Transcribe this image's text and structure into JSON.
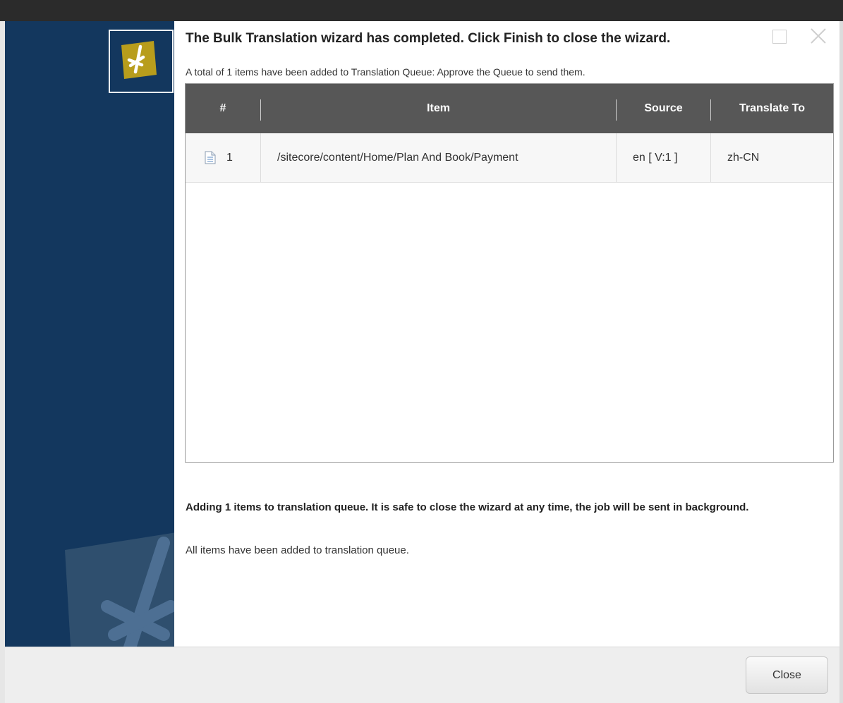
{
  "dialog": {
    "title": "The Bulk Translation wizard has completed. Click Finish to close the wizard.",
    "subtitle": "A total of 1 items have been added to Translation Queue: Approve the Queue to send them."
  },
  "table": {
    "columns": [
      "#",
      "Item",
      "Source",
      "Translate To"
    ],
    "rows": [
      {
        "icon": "document-icon",
        "number": "1",
        "item": "/sitecore/content/Home/Plan And Book/Payment",
        "source": "en [ V:1 ]",
        "translate_to": "zh-CN"
      }
    ]
  },
  "status": {
    "progress_prefix": "Adding ",
    "progress_count": "1",
    "progress_suffix": " items to translation queue. It is safe to close the wizard at any time, the job will be sent in background.",
    "result": "All items have been added to translation queue."
  },
  "footer": {
    "close_label": "Close"
  },
  "colors": {
    "sidebar": "#13375e",
    "logo_accent": "#b89d1c",
    "header": "#575757"
  }
}
